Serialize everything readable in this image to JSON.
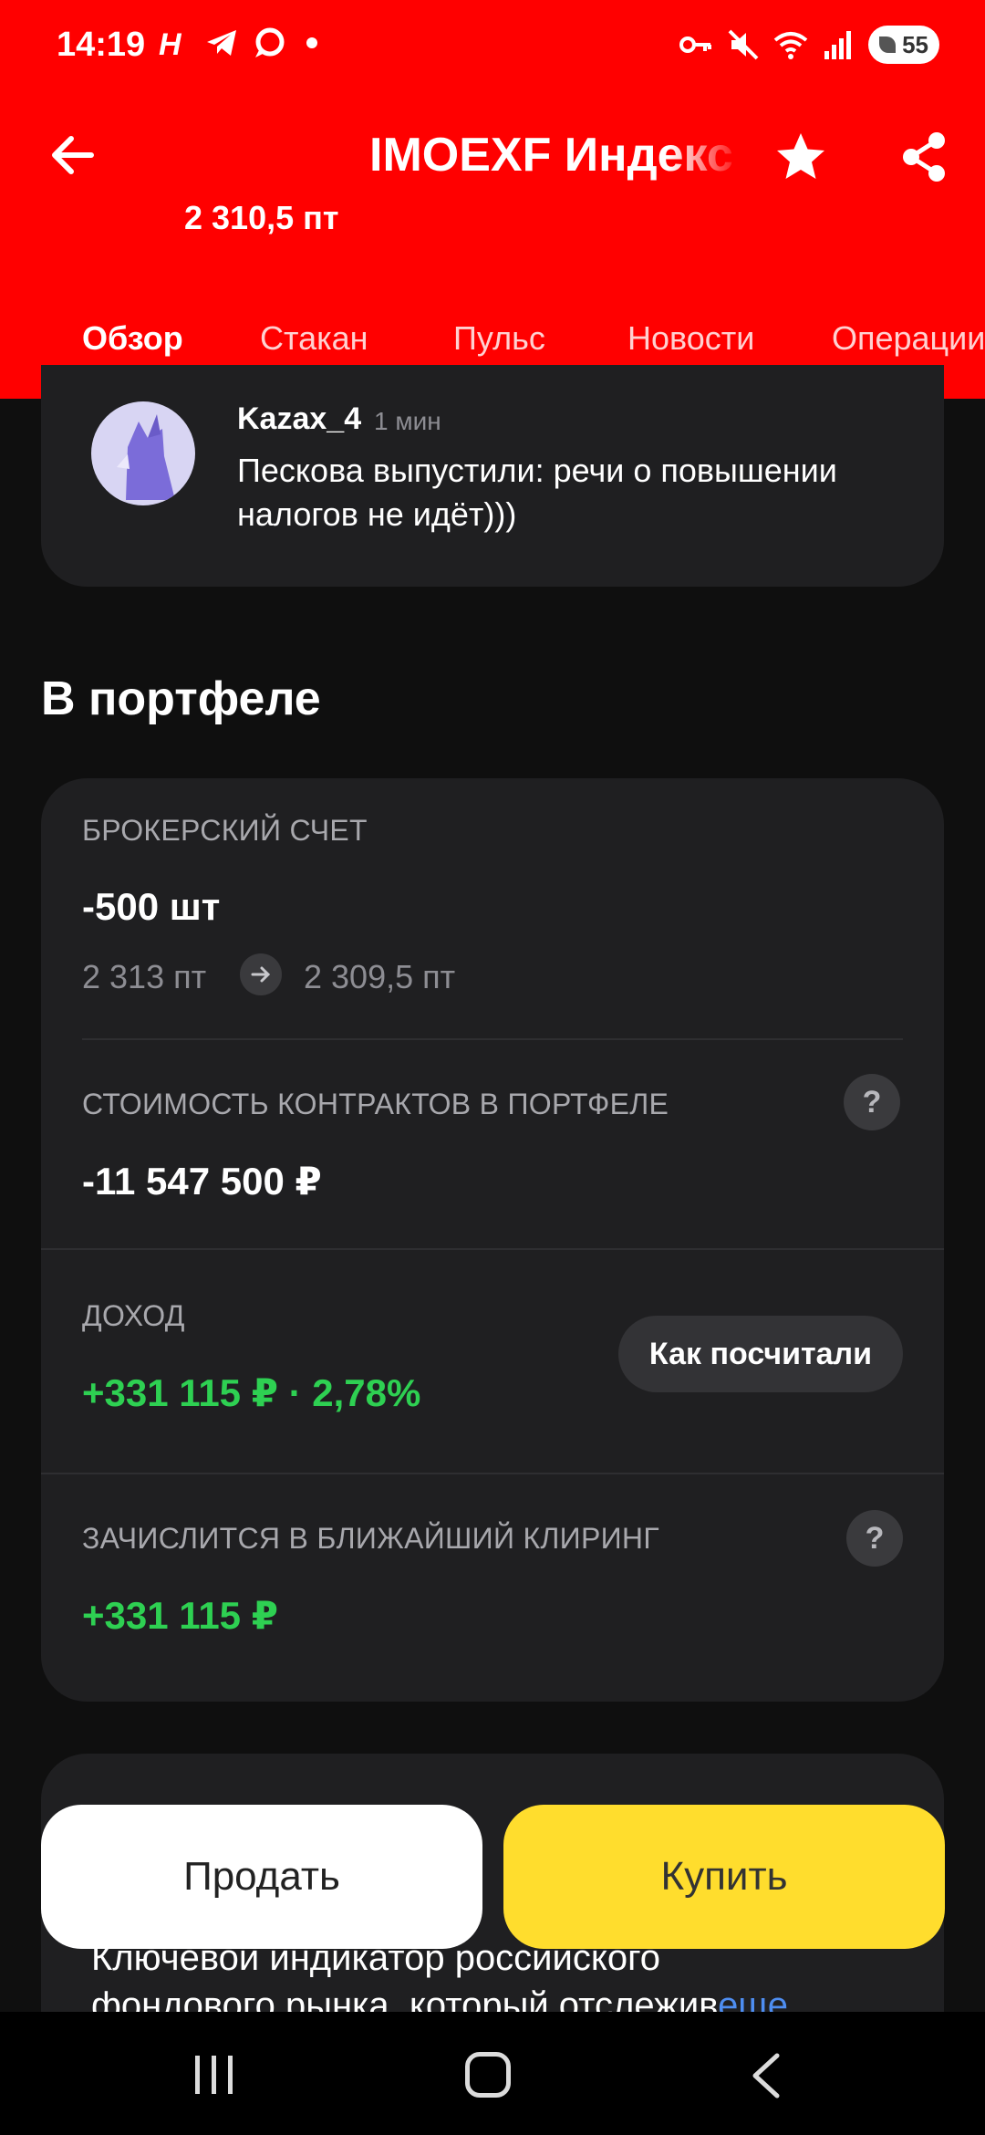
{
  "status_bar": {
    "time": "14:19",
    "battery": "55"
  },
  "header": {
    "title": "IMOEXF Индекс",
    "price": "2 310,5 пт",
    "tabs": [
      {
        "label": "Обзор",
        "active": true
      },
      {
        "label": "Стакан",
        "active": false
      },
      {
        "label": "Пульс",
        "active": false
      },
      {
        "label": "Новости",
        "active": false
      },
      {
        "label": "Операции",
        "active": false
      }
    ]
  },
  "pulse_post": {
    "author": "Kazax_4",
    "time": "1 мин",
    "text": "Пескова выпустили: речи о повышении налогов не идёт)))"
  },
  "portfolio": {
    "section_title": "В портфеле",
    "account_label": "БРОКЕРСКИЙ СЧЕТ",
    "quantity": "-500 шт",
    "price_from": "2 313 пт",
    "price_to": "2 309,5 пт",
    "contracts_value_label": "СТОИМОСТЬ КОНТРАКТОВ В ПОРТФЕЛЕ",
    "contracts_value": "-11 547 500 ₽",
    "income_label": "ДОХОД",
    "income_value": "+331 115 ₽ · 2,78%",
    "how_calculated_label": "Как посчитали",
    "clearing_label": "ЗАЧИСЛИТСЯ В БЛИЖАЙШИЙ КЛИРИНГ",
    "clearing_value": "+331 115 ₽",
    "help_symbol": "?"
  },
  "about": {
    "line1": "Ключевой индикатор российского",
    "line2": "фондового рынка, который отслежив",
    "more_link": "еще"
  },
  "actions": {
    "sell_label": "Продать",
    "buy_label": "Купить"
  },
  "colors": {
    "header_red": "#ff0000",
    "card_bg": "#1f1f21",
    "positive_green": "#2ed052",
    "buy_yellow": "#ffdd2d",
    "link_blue": "#4e8df0"
  }
}
